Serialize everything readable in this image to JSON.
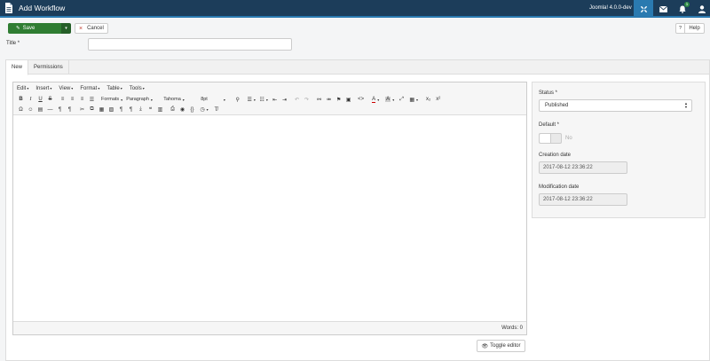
{
  "header": {
    "title": "Add Workflow",
    "version": "Joomla! 4.0.0-dev",
    "notification_count": "1"
  },
  "toolbar": {
    "save_label": "Save",
    "cancel_label": "Cancel",
    "help_q": "?",
    "help_label": "Help"
  },
  "form": {
    "title_label": "Title *",
    "title_value": ""
  },
  "tabs": [
    {
      "label": "New"
    },
    {
      "label": "Permissions"
    }
  ],
  "editor": {
    "menus": [
      "Edit",
      "Insert",
      "View",
      "Format",
      "Table",
      "Tools"
    ],
    "formats_label": "Formats",
    "block_label": "Paragraph",
    "font_label": "Tahoma",
    "size_label": "8pt",
    "words_label": "Words: 0",
    "toggle_label": "Toggle editor"
  },
  "side": {
    "status_label": "Status *",
    "status_value": "Published",
    "default_label": "Default *",
    "default_value": "No",
    "creation_label": "Creation date",
    "creation_value": "2017-08-12 23:36:22",
    "modification_label": "Modification date",
    "modification_value": "2017-08-12 23:36:22"
  },
  "colors": {
    "header_bg": "#1c3d5a",
    "accent": "#2a7ab0",
    "save_green": "#2f7d32"
  }
}
